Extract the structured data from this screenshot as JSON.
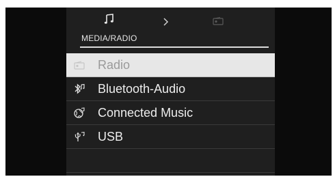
{
  "header": {
    "title": "MEDIA/RADIO"
  },
  "menu": {
    "items": [
      {
        "label": "Radio",
        "icon": "radio-icon",
        "selected": true
      },
      {
        "label": "Bluetooth-Audio",
        "icon": "bluetooth-audio-icon",
        "selected": false
      },
      {
        "label": "Connected Music",
        "icon": "connected-music-icon",
        "selected": false
      },
      {
        "label": "USB",
        "icon": "usb-icon",
        "selected": false
      }
    ]
  },
  "colors": {
    "panel_bg": "#1f1f1f",
    "outer_bg": "#0b0b0b",
    "selected_bg": "#e7e7e7",
    "text": "#ededed",
    "selected_text": "#9a9a9a"
  }
}
